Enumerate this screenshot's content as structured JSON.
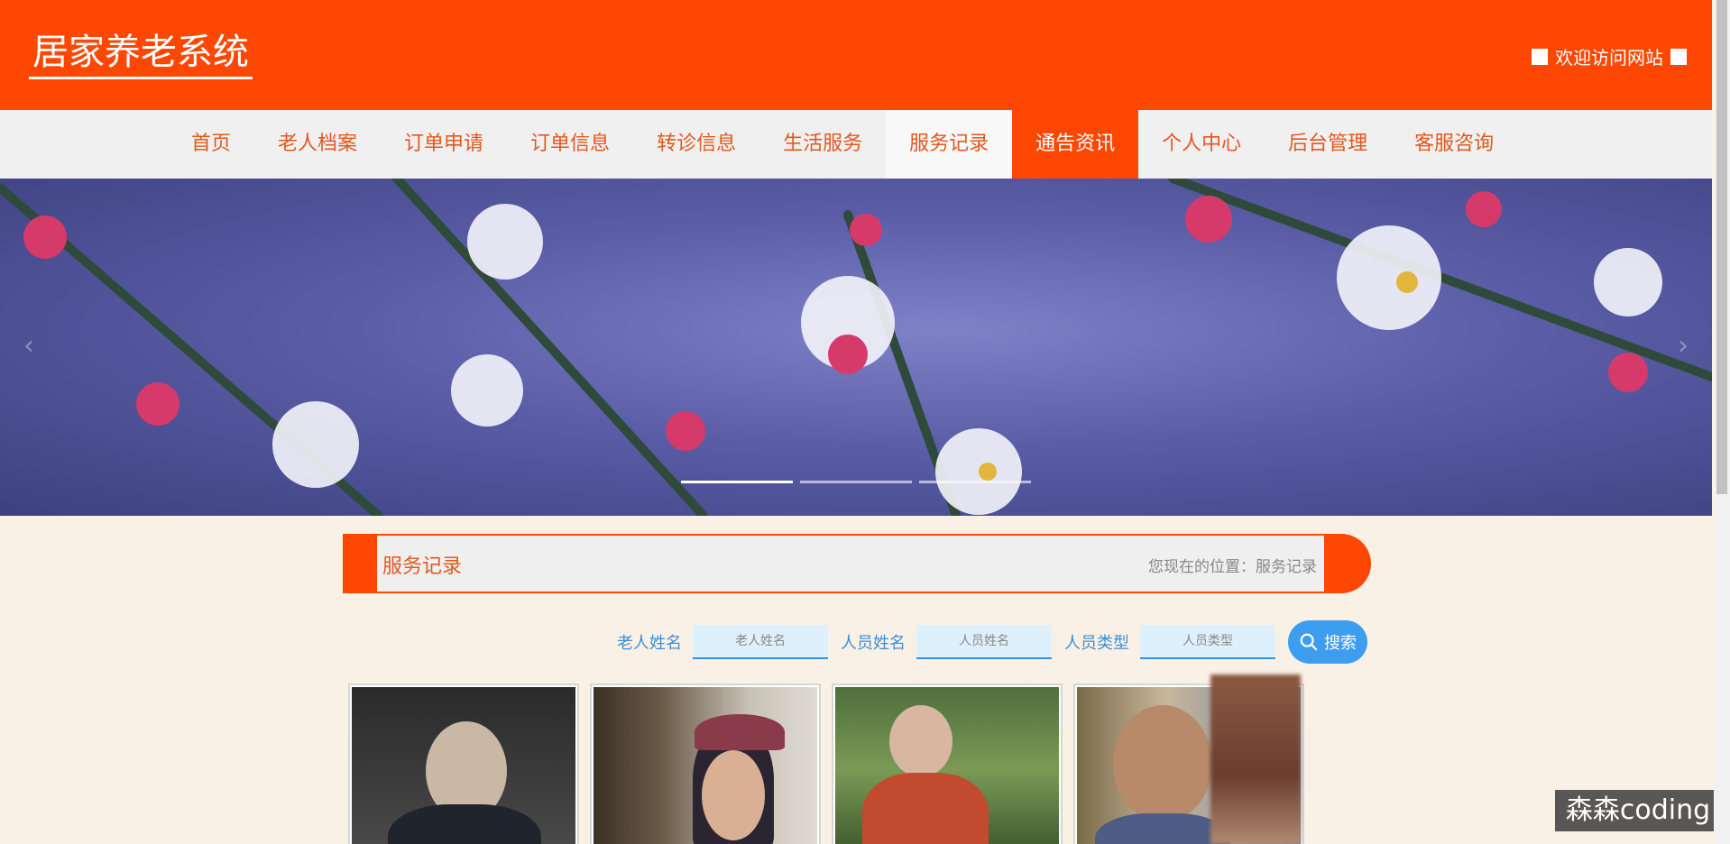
{
  "header": {
    "site_title": "居家养老系统",
    "welcome": "欢迎访问网站"
  },
  "nav": {
    "items": [
      {
        "label": "首页"
      },
      {
        "label": "老人档案"
      },
      {
        "label": "订单申请"
      },
      {
        "label": "订单信息"
      },
      {
        "label": "转诊信息"
      },
      {
        "label": "生活服务"
      },
      {
        "label": "服务记录"
      },
      {
        "label": "通告资讯"
      },
      {
        "label": "个人中心"
      },
      {
        "label": "后台管理"
      },
      {
        "label": "客服咨询"
      }
    ],
    "active": "通告资讯",
    "current": "服务记录"
  },
  "banner": {
    "arrow_left": "‹",
    "arrow_right": "›",
    "slide_count": 3,
    "active_slide": 1
  },
  "section": {
    "title": "服务记录",
    "location_prefix": "您现在的位置：",
    "location": "服务记录"
  },
  "search": {
    "elder_name_label": "老人姓名",
    "elder_name_placeholder": "老人姓名",
    "staff_name_label": "人员姓名",
    "staff_name_placeholder": "人员姓名",
    "staff_type_label": "人员类型",
    "staff_type_placeholder": "人员类型",
    "button_label": "搜索"
  },
  "cards": [
    {
      "name": "elder-photo-1"
    },
    {
      "name": "elder-photo-2"
    },
    {
      "name": "elder-photo-3"
    },
    {
      "name": "elder-photo-4"
    }
  ],
  "watermark": "森森coding",
  "colors": {
    "primary": "#fe4703",
    "nav_bg": "#f0f0f0",
    "page_bg": "#faf1e6",
    "search_accent": "#3b8fd8"
  }
}
